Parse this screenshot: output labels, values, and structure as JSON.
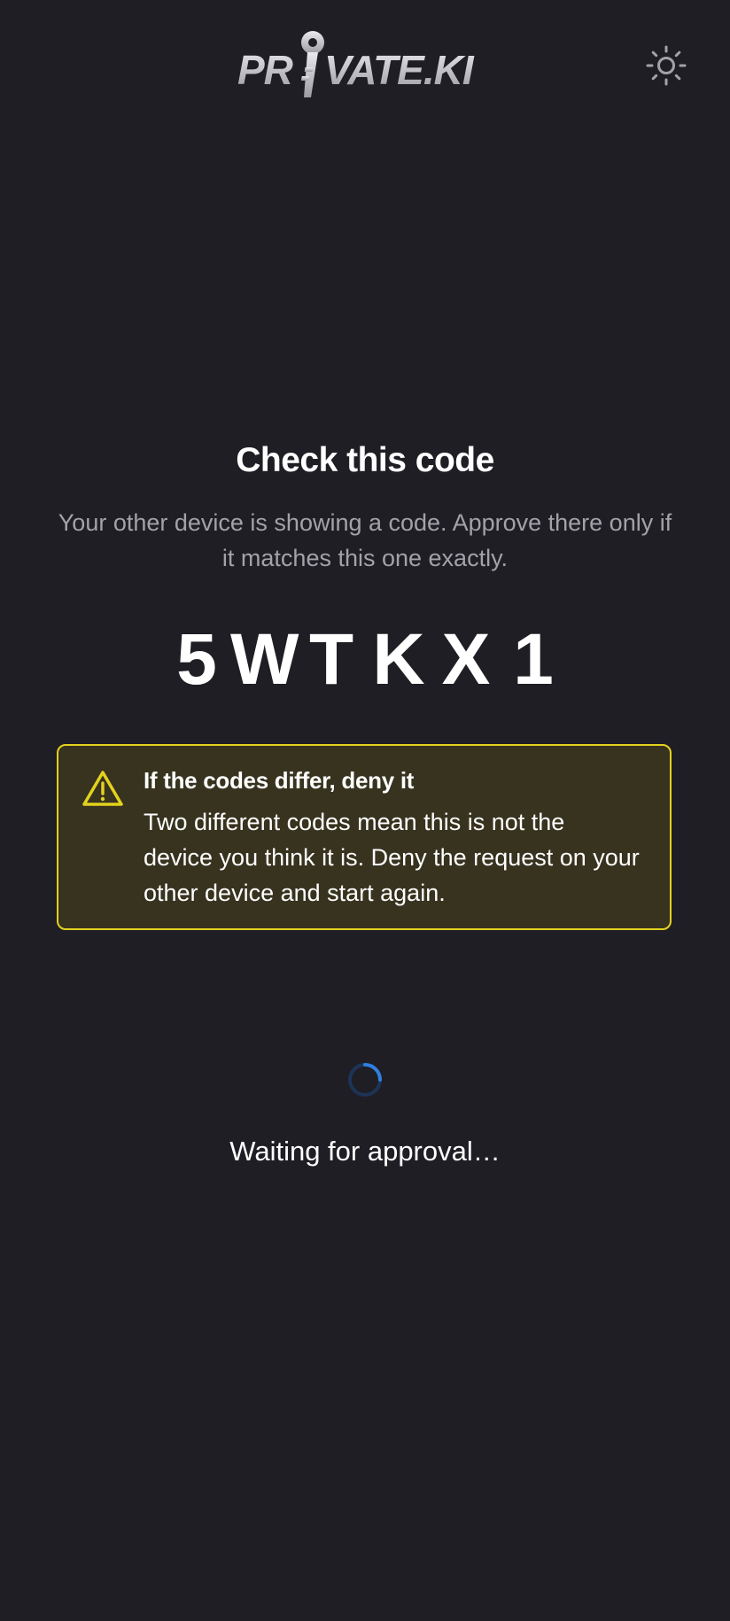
{
  "header": {
    "logo_text": "PRIVATE.KI",
    "logo_icon": "key-icon",
    "theme_toggle_icon": "sun-icon"
  },
  "main": {
    "title": "Check this code",
    "subtitle": "Your other device is showing a code. Approve there only if it matches this one exactly.",
    "code": [
      "5",
      "W",
      "T",
      "K",
      "X",
      "1"
    ]
  },
  "warning": {
    "icon": "warning-triangle-icon",
    "title": "If the codes differ, deny it",
    "body": "Two different codes mean this is not the device you think it is. Deny the request on your other device and start again."
  },
  "status": {
    "spinner_icon": "loading-spinner-icon",
    "text": "Waiting for approval…"
  },
  "colors": {
    "background": "#1f1e24",
    "warning_border": "#e3d21e",
    "warning_background": "#37331f",
    "spinner_accent": "#2f7fe0"
  }
}
